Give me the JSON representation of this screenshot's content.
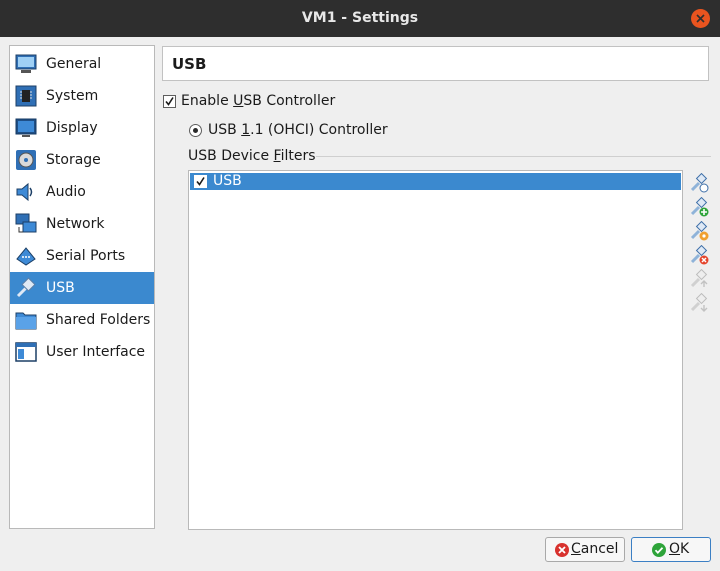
{
  "window": {
    "title": "VM1 - Settings"
  },
  "sidebar": {
    "items": [
      {
        "label": "General",
        "icon": "general-icon"
      },
      {
        "label": "System",
        "icon": "system-icon"
      },
      {
        "label": "Display",
        "icon": "display-icon"
      },
      {
        "label": "Storage",
        "icon": "storage-icon"
      },
      {
        "label": "Audio",
        "icon": "audio-icon"
      },
      {
        "label": "Network",
        "icon": "network-icon"
      },
      {
        "label": "Serial Ports",
        "icon": "serial-ports-icon"
      },
      {
        "label": "USB",
        "icon": "usb-icon",
        "selected": true
      },
      {
        "label": "Shared Folders",
        "icon": "shared-folders-icon"
      },
      {
        "label": "User Interface",
        "icon": "user-interface-icon"
      }
    ]
  },
  "page": {
    "title": "USB",
    "enable_usb": {
      "label_pre": "Enable ",
      "label_mn": "U",
      "label_post": "SB Controller",
      "checked": true
    },
    "controller": {
      "label_pre": "USB ",
      "label_mn": "1",
      "label_post": ".1 (OHCI) Controller",
      "selected": true
    },
    "filters": {
      "group_pre": "USB Device ",
      "group_mn": "F",
      "group_post": "ilters",
      "items": [
        {
          "label": "USB",
          "checked": true
        }
      ]
    }
  },
  "toolbar": {
    "buttons": [
      "add-empty-filter",
      "add-filter-from-device",
      "edit-filter",
      "remove-filter",
      "move-filter-up",
      "move-filter-down"
    ]
  },
  "buttons": {
    "cancel": {
      "mn": "C",
      "rest": "ancel"
    },
    "ok": {
      "mn": "O",
      "rest": "K"
    }
  },
  "colors": {
    "accent": "#3b89cf",
    "titlebar": "#2e2e2e",
    "close": "#e9541f"
  }
}
